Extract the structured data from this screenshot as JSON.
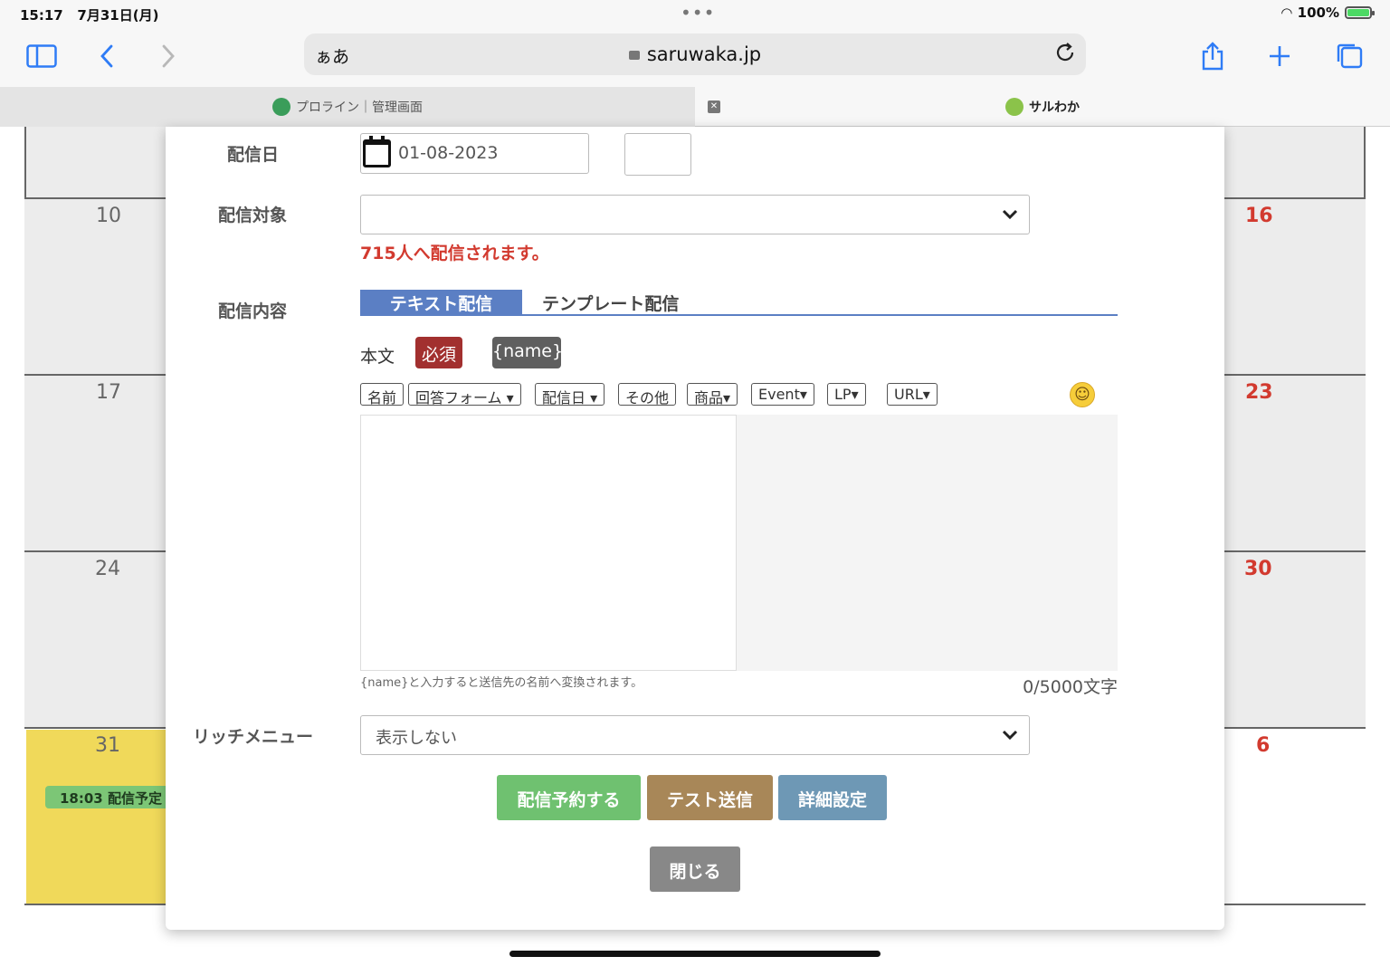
{
  "status": {
    "time": "15:17",
    "date": "7月31日(月)",
    "battery": "100%"
  },
  "browser": {
    "aa_label": "ぁあ",
    "url": "saruwaka.jp",
    "tabs": [
      {
        "label": "プロライン｜管理画面"
      },
      {
        "label": "サルわか"
      }
    ]
  },
  "calendar": {
    "rows": [
      {
        "left": "10",
        "right": "16"
      },
      {
        "left": "17",
        "right": "23"
      },
      {
        "left": "24",
        "right": "30"
      },
      {
        "left": "31",
        "right": "6"
      }
    ],
    "event": "18:03 配信予定",
    "today_color": "#f0d95a",
    "event_color": "#7cc676"
  },
  "form": {
    "date_label": "配信日",
    "date_value": "01-08-2023",
    "time_value": "",
    "target_label": "配信対象",
    "target_value": "",
    "target_notice": "715人へ配信されます。",
    "content_label": "配信内容",
    "tabs": {
      "active": "テキスト配信",
      "inactive": "テンプレート配信"
    },
    "body_label": "本文",
    "required_badge": "必須",
    "name_badge": "{name}",
    "insert_buttons": [
      "名前",
      "回答フォーム ▾",
      "配信日 ▾",
      "その他",
      "商品▾",
      "Event▾",
      "LP▾",
      "URL▾"
    ],
    "body_value": "",
    "hint": "{name}と入力すると送信先の名前へ変換されます。",
    "counter": "0/5000文字",
    "rich_menu_label": "リッチメニュー",
    "rich_menu_value": "表示しない"
  },
  "buttons": {
    "reserve": "配信予約する",
    "test": "テスト送信",
    "detail": "詳細設定",
    "close": "閉じる"
  },
  "colors": {
    "accent_tab": "#5b7fc4",
    "notice_red": "#d23a2f",
    "reserve": "#6fc170",
    "test": "#a88758",
    "detail": "#6e98b5",
    "close": "#888888"
  }
}
